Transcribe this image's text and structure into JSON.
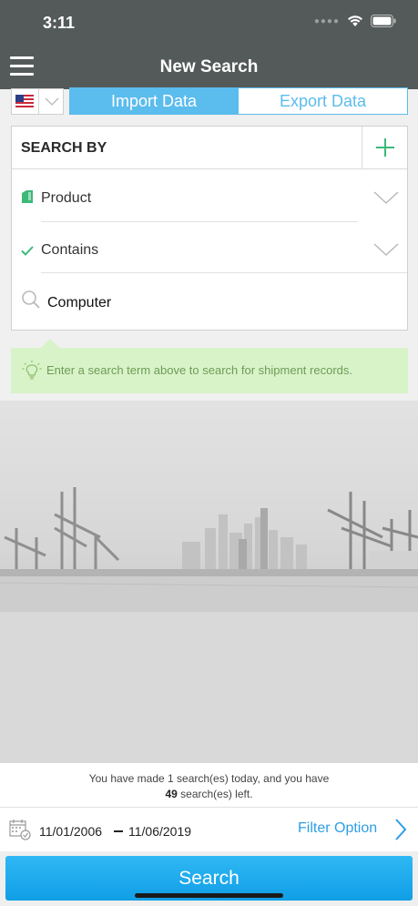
{
  "status_bar": {
    "time": "3:11"
  },
  "nav": {
    "title": "New Search"
  },
  "data_toggle": {
    "import_label": "Import Data",
    "export_label": "Export Data",
    "selected": "import"
  },
  "search_by": {
    "header": "SEARCH BY",
    "field": "Product",
    "condition": "Contains",
    "query": "Computer"
  },
  "tip": {
    "text": "Enter a search term above to search for shipment records."
  },
  "quota": {
    "line1": "You have made 1 search(es) today, and you have",
    "remaining_count": "49",
    "remaining_suffix": " search(es)  left."
  },
  "date_range": {
    "from": "11/01/2006",
    "to": "11/06/2019"
  },
  "filter": {
    "label": "Filter Option"
  },
  "actions": {
    "search_label": "Search"
  },
  "colors": {
    "nav_bg": "#545a59",
    "accent": "#5bbcee",
    "link": "#2e9ee6",
    "check": "#3cb878",
    "tip_bg": "#d9f3c9"
  },
  "icons": [
    "menu-icon",
    "us-flag-icon",
    "chevron-down-icon",
    "plus-icon",
    "tag-icon",
    "checkmark-icon",
    "search-icon",
    "lightbulb-icon",
    "calendar-icon",
    "chevron-right-icon",
    "wifi-icon",
    "battery-icon"
  ]
}
